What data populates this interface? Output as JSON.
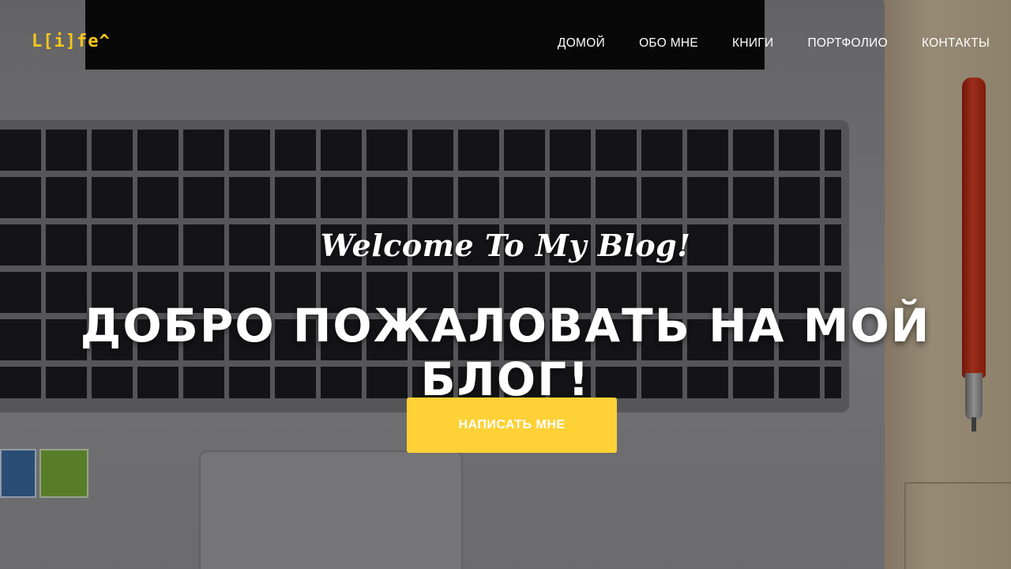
{
  "header": {
    "logo_text": "L[i]fe^",
    "nav": [
      {
        "label": "ДОМОЙ"
      },
      {
        "label": "ОБО МНЕ"
      },
      {
        "label": "КНИГИ"
      },
      {
        "label": "ПОРТФОЛИО"
      },
      {
        "label": "КОНТАКТЫ"
      }
    ]
  },
  "hero": {
    "subheading": "Welcome To My Blog!",
    "heading": "ДОБРО ПОЖАЛОВАТЬ НА МОЙ БЛОГ!",
    "cta_label": "НАПИСАТЬ МНЕ"
  },
  "colors": {
    "accent": "#fed136",
    "logo": "#f5c61b",
    "text": "#ffffff"
  }
}
